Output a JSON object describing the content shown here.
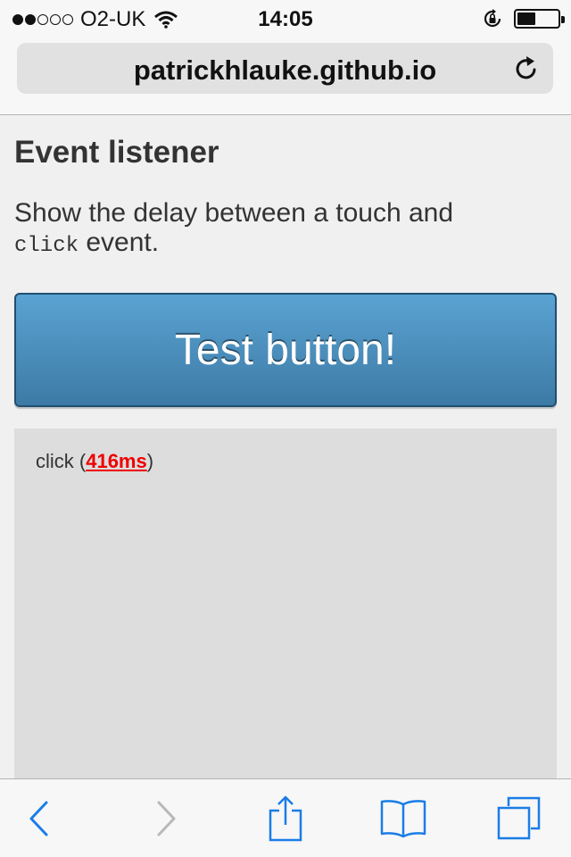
{
  "status_bar": {
    "carrier": "O2-UK",
    "time": "14:05",
    "signal_strength": 2,
    "signal_max": 5,
    "battery_level": 0.45
  },
  "browser": {
    "url": "patrickhlauke.github.io",
    "reload_icon": "reload-icon"
  },
  "page": {
    "title": "Event listener",
    "description_before": "Show the delay between a touch and",
    "description_code": "click",
    "description_after": " event.",
    "button_label": "Test button!"
  },
  "log": {
    "event": "click (",
    "delay": "416ms",
    "close": ")"
  },
  "toolbar": {
    "items": [
      "back-icon",
      "forward-icon",
      "share-icon",
      "bookmarks-icon",
      "tabs-icon"
    ]
  },
  "colors": {
    "accent": "#1a7de6",
    "button_top": "#5aa3d2",
    "button_bottom": "#3d7aa6",
    "delay_text": "#ee0000"
  }
}
